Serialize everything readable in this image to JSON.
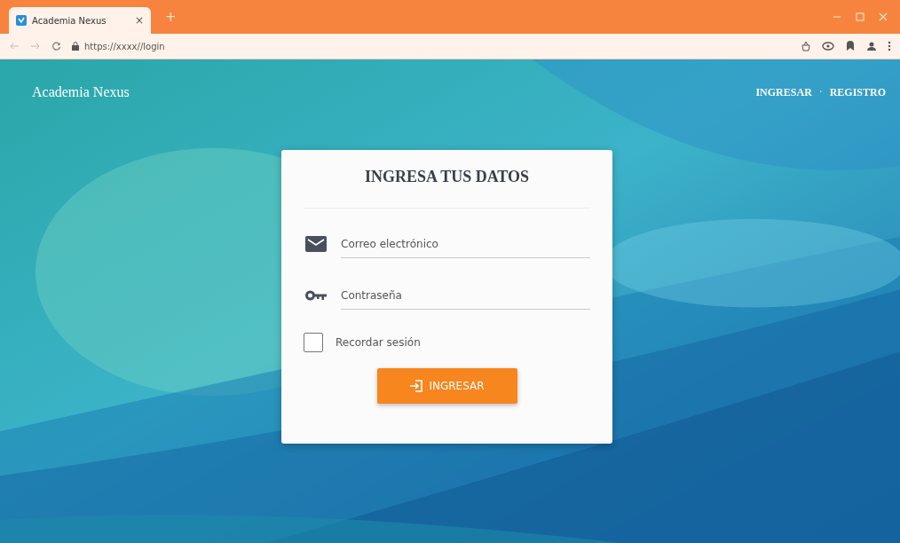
{
  "browser": {
    "tab_title": "Academia Nexus",
    "tab_close": "×",
    "new_tab": "+",
    "url": "https://xxxx//login"
  },
  "navbar": {
    "brand": "Academia Nexus",
    "links": [
      {
        "label": "INGRESAR"
      },
      {
        "label": "REGISTRO"
      }
    ],
    "separator": "·"
  },
  "login_card": {
    "title": "INGRESA TUS DATOS",
    "fields": [
      {
        "kind": "email",
        "placeholder": "Correo electrónico"
      },
      {
        "kind": "password",
        "placeholder": "Contraseña"
      }
    ],
    "remember": {
      "label": "Recordar sesión",
      "checked": false
    },
    "submit": "INGRESAR"
  }
}
